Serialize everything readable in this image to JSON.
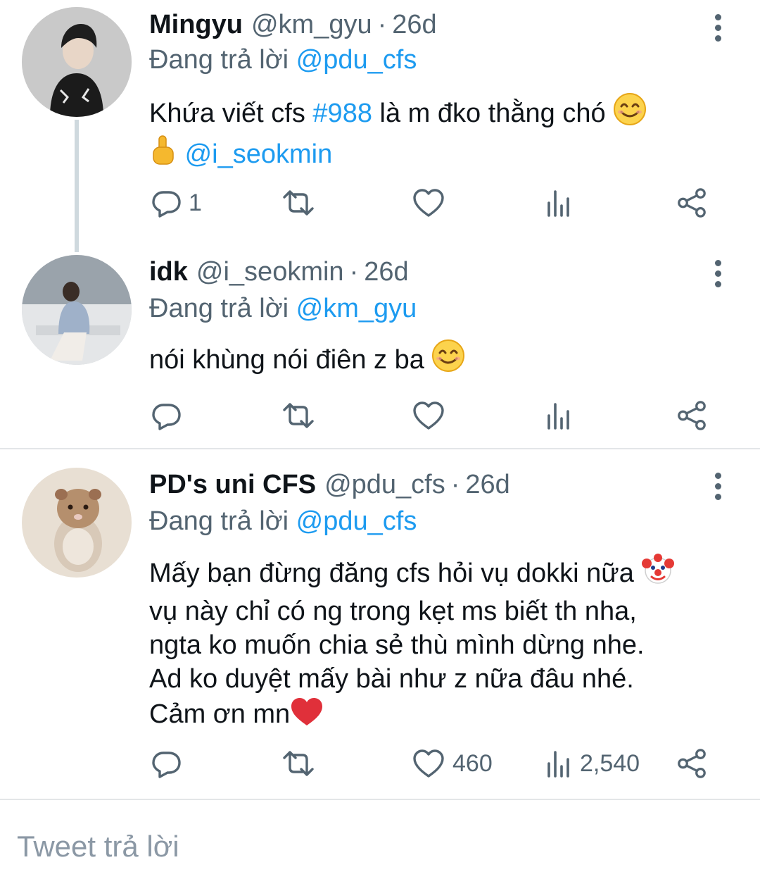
{
  "tweets": [
    {
      "name": "Mingyu",
      "handle": "@km_gyu",
      "separator": "·",
      "time": "26d",
      "reply_prefix": "Đang trả lời",
      "reply_to": "@pdu_cfs",
      "text_1": "Khứa viết cfs ",
      "hashtag": "#988",
      "text_2": " là m đko thằng chó ",
      "mention": "@i_seokmin",
      "reply_count": "1",
      "retweet_count": "",
      "like_count": "",
      "view_count": ""
    },
    {
      "name": "idk",
      "handle": "@i_seokmin",
      "separator": "·",
      "time": "26d",
      "reply_prefix": "Đang trả lời",
      "reply_to": "@km_gyu",
      "text": "nói khùng nói điên z ba ",
      "reply_count": "",
      "retweet_count": "",
      "like_count": "",
      "view_count": ""
    },
    {
      "name": "PD's uni CFS",
      "handle": "@pdu_cfs",
      "separator": "·",
      "time": "26d",
      "reply_prefix": "Đang trả lời",
      "reply_to": "@pdu_cfs",
      "line_1": "Mấy bạn đừng đăng cfs hỏi vụ dokki nữa",
      "line_2": "vụ này chỉ có ng trong kẹt ms biết th nha,",
      "line_3": "ngta ko muốn chia sẻ thù mình dừng nhe.",
      "line_4": "Ad ko duyệt mấy bài như z nữa đâu nhé.",
      "line_5": "Cảm ơn mn",
      "reply_count": "",
      "retweet_count": "",
      "like_count": "460",
      "view_count": "2,540"
    }
  ],
  "compose": {
    "placeholder": "Tweet trả lời"
  },
  "colors": {
    "link": "#1d9bf0",
    "secondary": "#536471",
    "thread_line": "#cfd9de",
    "divider": "#e3e6e8"
  },
  "icons": [
    "reply-icon",
    "retweet-icon",
    "like-icon",
    "views-icon",
    "share-icon",
    "more-icon",
    "smile-emoji",
    "pointing-finger-emoji",
    "clown-emoji",
    "heart-emoji"
  ]
}
